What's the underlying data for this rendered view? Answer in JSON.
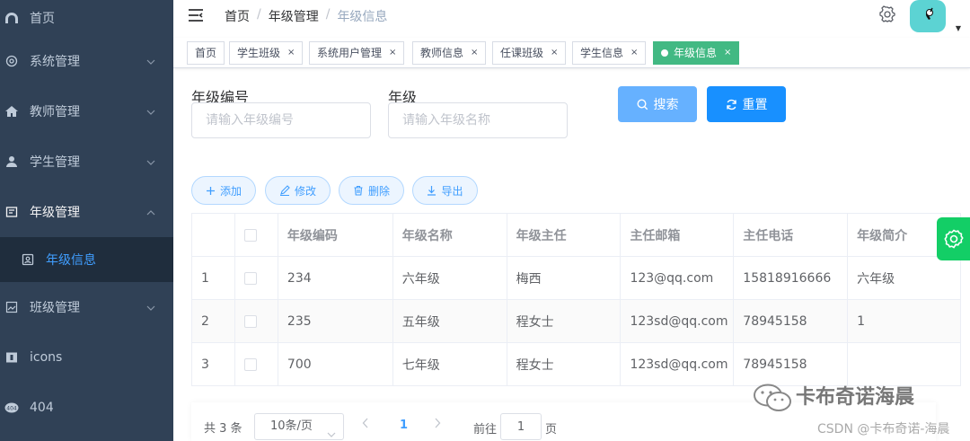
{
  "sidebar": {
    "items": [
      {
        "label": "首页",
        "icon": "dashboard-icon"
      },
      {
        "label": "系统管理",
        "icon": "gear-icon"
      },
      {
        "label": "教师管理",
        "icon": "home-icon"
      },
      {
        "label": "学生管理",
        "icon": "user-icon"
      },
      {
        "label": "年级管理",
        "icon": "form-icon"
      },
      {
        "label": "年级信息",
        "icon": "id-card-icon"
      },
      {
        "label": "班级管理",
        "icon": "image-icon"
      },
      {
        "label": "icons",
        "icon": "education-icon"
      },
      {
        "label": "404",
        "icon": "404-icon"
      }
    ]
  },
  "navbar": {
    "breadcrumb": [
      "首页",
      "年级管理",
      "年级信息"
    ]
  },
  "tags": [
    {
      "label": "首页"
    },
    {
      "label": "学生班级"
    },
    {
      "label": "系统用户管理"
    },
    {
      "label": "教师信息"
    },
    {
      "label": "任课班级"
    },
    {
      "label": "学生信息"
    },
    {
      "label": "年级信息"
    }
  ],
  "search": {
    "grade_code_label": "年级编号",
    "grade_code_placeholder": "请输入年级编号",
    "grade_label": "年级",
    "grade_placeholder": "请输入年级名称",
    "search_button": "搜索",
    "reset_button": "重置"
  },
  "toolbar": {
    "add": "添加",
    "edit": "修改",
    "delete": "删除",
    "export": "导出"
  },
  "table": {
    "headers": [
      "年级编码",
      "年级名称",
      "年级主任",
      "主任邮箱",
      "主任电话",
      "年级简介"
    ],
    "rows": [
      {
        "index": "1",
        "code": "234",
        "name": "六年级",
        "director": "梅西",
        "email": "123@qq.com",
        "phone": "15818916666",
        "intro": "六年级"
      },
      {
        "index": "2",
        "code": "235",
        "name": "五年级",
        "director": "程女士",
        "email": "123sd@qq.com",
        "phone": "78945158",
        "intro": "1"
      },
      {
        "index": "3",
        "code": "700",
        "name": "七年级",
        "director": "程女士",
        "email": "123sd@qq.com",
        "phone": "78945158",
        "intro": ""
      }
    ]
  },
  "pagination": {
    "total": "共 3 条",
    "page_size": "10条/页",
    "current_page": "1",
    "goto": "前往",
    "jump_value": "1",
    "page_unit": "页"
  },
  "watermark": {
    "name": "卡布奇诺海晨",
    "csdn": "CSDN @卡布奇诺-海晨"
  },
  "colors": {
    "sidebar_bg": "#304156",
    "active_tag": "#42b983",
    "primary": "#409eff",
    "float_settings": "#13ce66"
  }
}
